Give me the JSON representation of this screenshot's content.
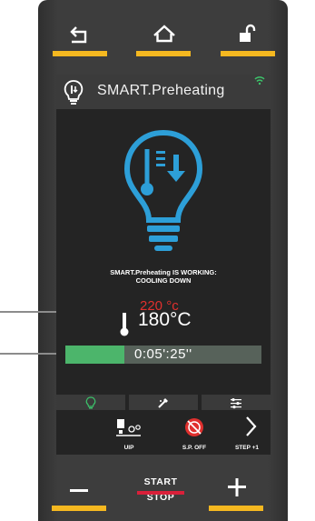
{
  "header": {
    "title": "SMART.Preheating"
  },
  "main": {
    "status_line1": "SMART.Preheating IS WORKING:",
    "status_line2": "COOLING DOWN",
    "setpoint_temp": "220 °c",
    "current_temp": "180°C",
    "timer": "0:05':25''",
    "progress_fraction": 0.3
  },
  "bottom_row": {
    "uip_label": "UIP",
    "sp_off_label": "S.P. OFF",
    "step_label": "STEP +1"
  },
  "controls": {
    "start_label": "START",
    "stop_label": "STOP"
  },
  "colors": {
    "accent_yellow": "#f5b820",
    "icon_blue": "#2d9fd8",
    "setpoint_red": "#e0302e",
    "progress_green": "#4cb56b",
    "stop_red": "#d9203a"
  }
}
